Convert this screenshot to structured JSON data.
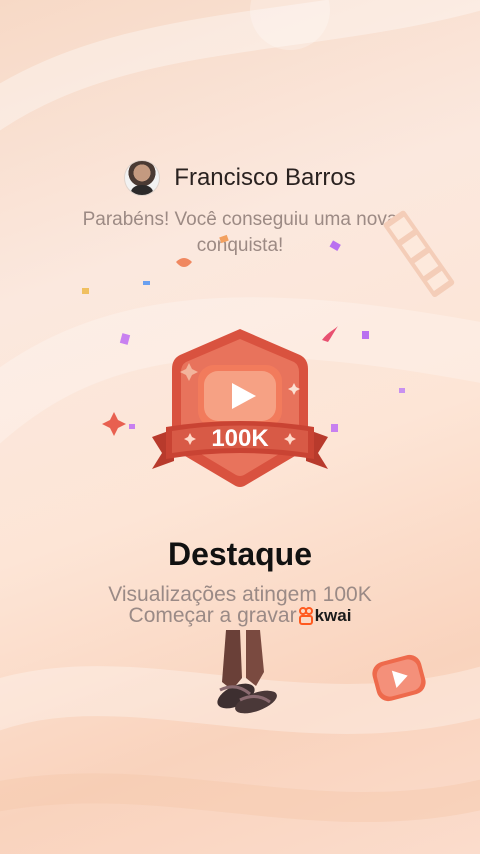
{
  "user": {
    "name": "Francisco Barros"
  },
  "message": {
    "congrats": "Parabéns! Você conseguiu uma nova conquista!"
  },
  "badge": {
    "value_label": "100K",
    "title": "Destaque",
    "description": "Visualizações atingem 100K"
  },
  "cta": {
    "record_label": "Começar a gravar",
    "brand": "kwai"
  },
  "colors": {
    "badge_red": "#d84b3a",
    "badge_dark": "#b8372a",
    "badge_light": "#f0765c",
    "brand_orange": "#ff5a1f",
    "background": "#fbe8de"
  },
  "icons": {
    "avatar": "user-avatar",
    "badge": "play-badge-icon",
    "logo": "kwai-logo-icon"
  }
}
